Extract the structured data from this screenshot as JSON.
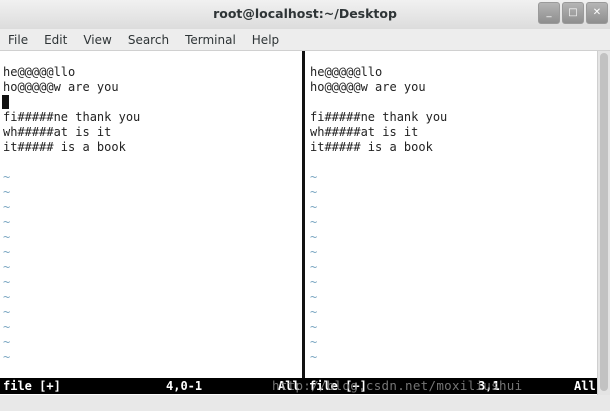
{
  "window": {
    "title": "root@localhost:~/Desktop",
    "controls": {
      "minimize": "_",
      "maximize": "□",
      "close": "✕"
    }
  },
  "menubar": {
    "items": [
      "File",
      "Edit",
      "View",
      "Search",
      "Terminal",
      "Help"
    ]
  },
  "editor": {
    "left_pane": {
      "lines": [
        "he@@@@@llo",
        "ho@@@@@w are you",
        "",
        "fi#####ne thank you",
        "wh#####at is it",
        "it##### is a book"
      ],
      "tilde_count": 13
    },
    "right_pane": {
      "lines": [
        "he@@@@@llo",
        "ho@@@@@w are you",
        "",
        "fi#####ne thank you",
        "wh#####at is it",
        "it##### is a book"
      ],
      "tilde_count": 13
    },
    "tilde_glyph": "~",
    "statusbar": {
      "left_file": "file [+]",
      "left_position": "4,0-1",
      "left_scroll": "All",
      "right_file": "file [+]",
      "right_position": "3,1",
      "right_scroll": "All"
    },
    "watermark": "http://blog.csdn.net/moxiliushui"
  }
}
